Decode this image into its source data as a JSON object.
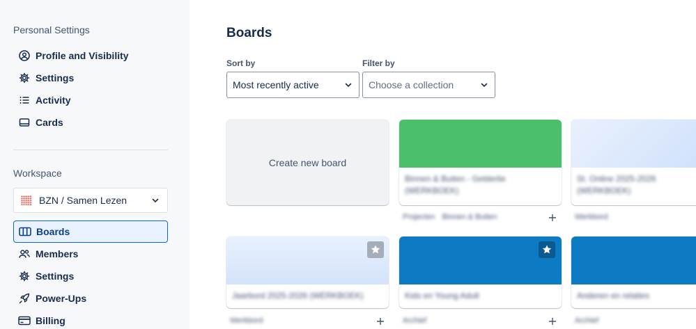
{
  "sidebar": {
    "personal_title": "Personal Settings",
    "personal_items": [
      {
        "label": "Profile and Visibility",
        "icon": "user-circle-icon"
      },
      {
        "label": "Settings",
        "icon": "gear-icon"
      },
      {
        "label": "Activity",
        "icon": "list-icon"
      },
      {
        "label": "Cards",
        "icon": "card-icon"
      }
    ],
    "workspace_title": "Workspace",
    "workspace_name": "BZN / Samen Lezen",
    "workspace_items": [
      {
        "label": "Boards",
        "icon": "board-icon",
        "active": true
      },
      {
        "label": "Members",
        "icon": "members-icon"
      },
      {
        "label": "Settings",
        "icon": "gear-icon"
      },
      {
        "label": "Power-Ups",
        "icon": "rocket-icon"
      },
      {
        "label": "Billing",
        "icon": "credit-card-icon"
      }
    ]
  },
  "main": {
    "title": "Boards",
    "sort_label": "Sort by",
    "sort_value": "Most recently active",
    "filter_label": "Filter by",
    "filter_placeholder": "Choose a collection",
    "create_label": "Create new board",
    "boards": [
      {
        "name": "Binnen & Buiten - Gelderlie (WERKBOEK)",
        "color": "#4bbf6b",
        "meta": [
          "Projecten",
          "Binnen & Buiten"
        ]
      },
      {
        "name": "St. Online 2025-2026 (WERKBOEK)",
        "color": "#d9e6fb",
        "meta": [
          "Werkbord"
        ]
      },
      {
        "name": "Jaarbord 2025-2026 (WERKBOEK)",
        "color": "#d9e6fb",
        "meta": [
          "Werkbord"
        ],
        "starred": true
      },
      {
        "name": "Kids en Young Adult",
        "color": "#0c7bc4",
        "meta": [
          "Archief"
        ],
        "starred": true
      },
      {
        "name": "Anderen en relaties",
        "color": "#0c7bc4",
        "meta": [
          "Archief"
        ]
      }
    ]
  }
}
